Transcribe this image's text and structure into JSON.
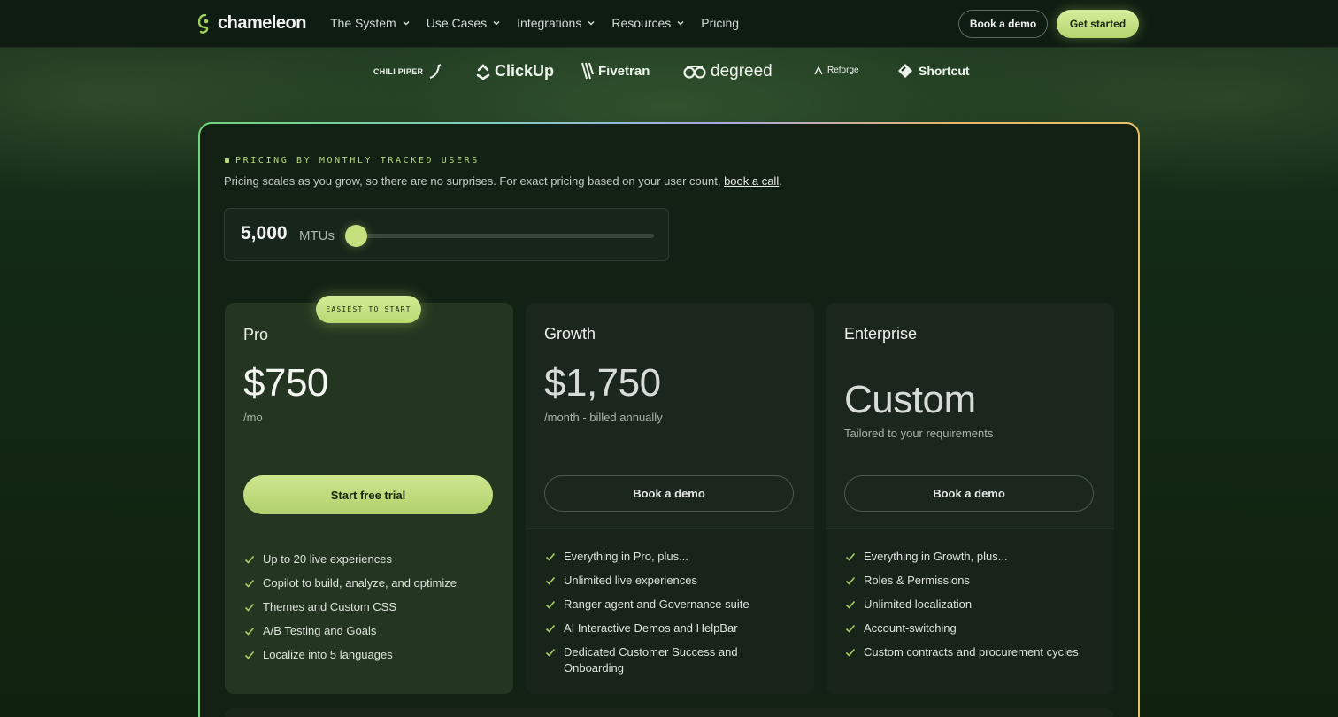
{
  "nav": {
    "logo": "chameleon",
    "menu": [
      {
        "label": "The System",
        "has_dropdown": true
      },
      {
        "label": "Use Cases",
        "has_dropdown": true
      },
      {
        "label": "Integrations",
        "has_dropdown": true
      },
      {
        "label": "Resources",
        "has_dropdown": true
      },
      {
        "label": "Pricing",
        "has_dropdown": false
      }
    ],
    "book_demo": "Book a demo",
    "get_started": "Get started"
  },
  "customer_logos": [
    "CHILI PIPER",
    "ClickUp",
    "Fivetran",
    "degreed",
    "Reforge",
    "Shortcut"
  ],
  "pricing": {
    "eyebrow": "PRICING BY MONTHLY TRACKED USERS",
    "subtext_before": "Pricing scales as you grow, so there are no surprises. For exact pricing based on your user count, ",
    "subtext_link": "book a call",
    "subtext_after": ".",
    "mtu_value": "5,000",
    "mtu_unit": "MTUs",
    "slider_level": 0
  },
  "plans": [
    {
      "name": "Pro",
      "badge": "EASIEST TO START",
      "price": "$750",
      "price_note": "/mo",
      "cta": "Start free trial",
      "features": [
        "Up to 20 live experiences",
        "Copilot to build, analyze, and optimize",
        "Themes and Custom CSS",
        "A/B Testing and Goals",
        "Localize into 5 languages"
      ]
    },
    {
      "name": "Growth",
      "price": "$1,750",
      "price_note": "/month - billed annually",
      "cta": "Book a demo",
      "features": [
        "Everything in Pro, plus...",
        "Unlimited live experiences",
        "Ranger agent and Governance suite",
        "AI Interactive Demos and HelpBar",
        "Dedicated Customer Success and Onboarding"
      ]
    },
    {
      "name": "Enterprise",
      "price": "Custom",
      "price_note": "Tailored to your requirements",
      "cta": "Book a demo",
      "features": [
        "Everything in Growth, plus...",
        "Roles & Permissions",
        "Unlimited localization",
        "Account-switching",
        "Custom contracts and procurement cycles"
      ]
    }
  ],
  "colors": {
    "accent": "#c6e07f",
    "background": "#0f1d12",
    "card": "#182419",
    "card_highlight": "#243621"
  }
}
